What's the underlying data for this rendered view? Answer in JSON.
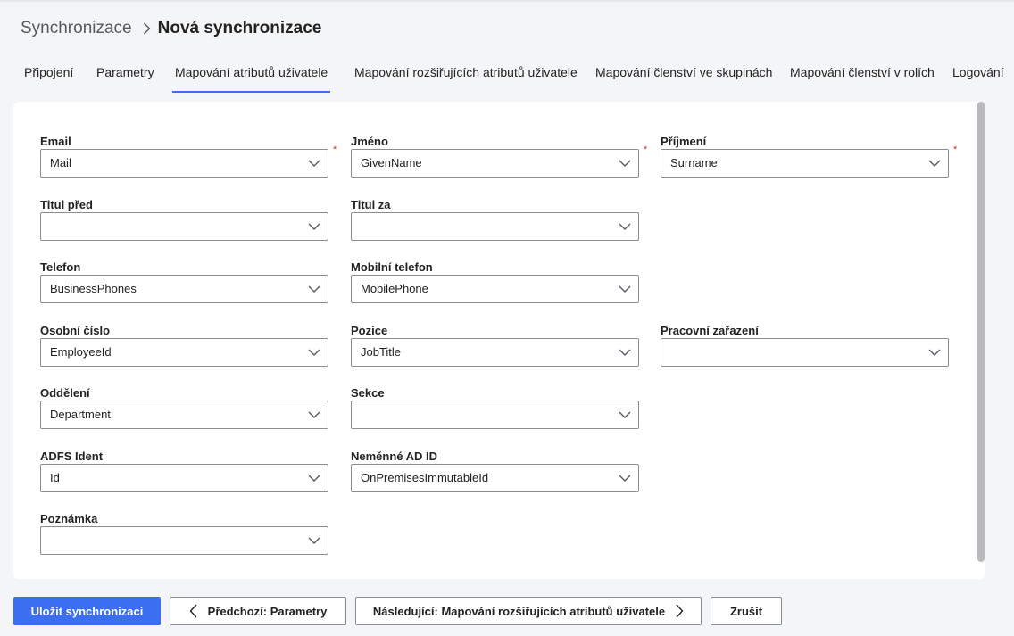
{
  "breadcrumb": {
    "parent": "Synchronizace",
    "current": "Nová synchronizace"
  },
  "tabs": [
    {
      "label": "Připojení",
      "active": false
    },
    {
      "label": "Parametry",
      "active": false
    },
    {
      "label": "Mapování atributů uživatele",
      "active": true
    },
    {
      "label": "Mapování rozšiřujících atributů uživatele",
      "active": false
    },
    {
      "label": "Mapování členství ve skupinách",
      "active": false
    },
    {
      "label": "Mapování členství v rolích",
      "active": false
    },
    {
      "label": "Logování",
      "active": false
    }
  ],
  "fields": {
    "email": {
      "label": "Email",
      "value": "Mail",
      "required": true
    },
    "jmeno": {
      "label": "Jméno",
      "value": "GivenName",
      "required": true
    },
    "prijmeni": {
      "label": "Příjmení",
      "value": "Surname",
      "required": true
    },
    "titul_pred": {
      "label": "Titul před",
      "value": ""
    },
    "titul_za": {
      "label": "Titul za",
      "value": ""
    },
    "telefon": {
      "label": "Telefon",
      "value": "BusinessPhones"
    },
    "mobilni_telefon": {
      "label": "Mobilní telefon",
      "value": "MobilePhone"
    },
    "osobni_cislo": {
      "label": "Osobní číslo",
      "value": "EmployeeId"
    },
    "pozice": {
      "label": "Pozice",
      "value": "JobTitle"
    },
    "pracovni_zarazeni": {
      "label": "Pracovní zařazení",
      "value": ""
    },
    "oddeleni": {
      "label": "Oddělení",
      "value": "Department"
    },
    "sekce": {
      "label": "Sekce",
      "value": ""
    },
    "adfs_ident": {
      "label": "ADFS Ident",
      "value": "Id"
    },
    "nemenne_ad_id": {
      "label": "Neměnné AD ID",
      "value": "OnPremisesImmutableId"
    },
    "poznamka": {
      "label": "Poznámka",
      "value": ""
    }
  },
  "required_marker": "*",
  "buttons": {
    "save": "Uložit synchronizaci",
    "previous": "Předchozí: Parametry",
    "next": "Následující: Mapování rozšiřujících atributů uživatele",
    "cancel": "Zrušit"
  },
  "colors": {
    "accent": "#3b6ef0",
    "required": "#c0392b",
    "background": "#f4f5f7"
  }
}
